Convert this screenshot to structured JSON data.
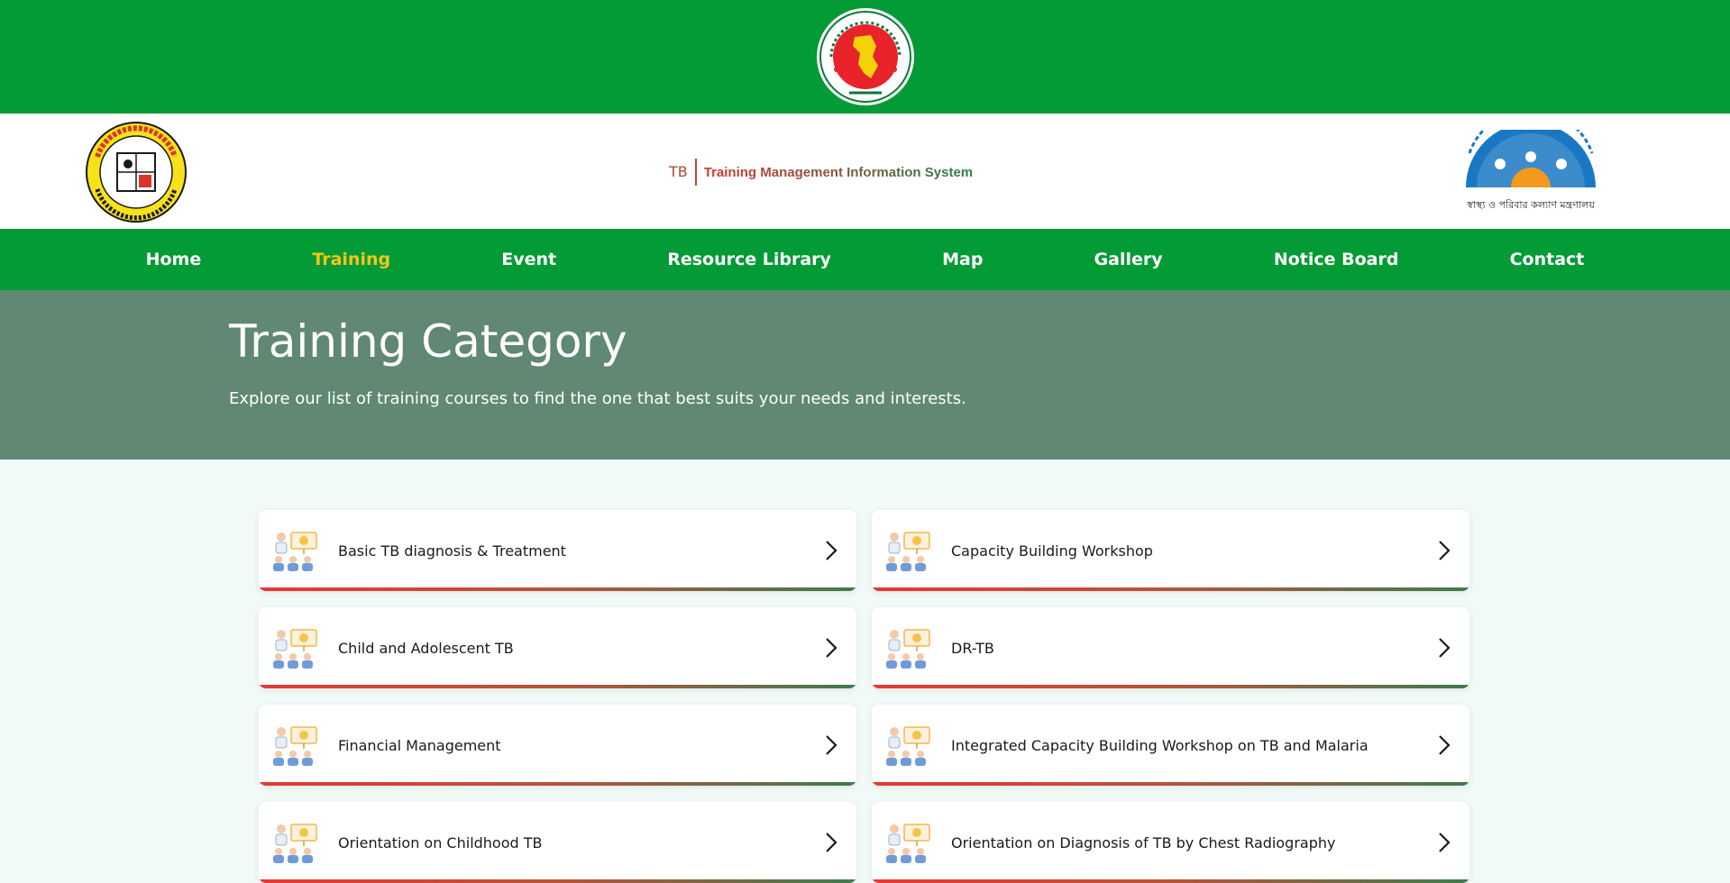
{
  "header": {
    "emblem_icon": "bangladesh-government-emblem",
    "left_logo_icon": "ntp-tb-program-logo",
    "right_logo_icon": "hpnsp-ministry-logo",
    "right_logo_caption": "স্বাস্থ্য ও পরিবার কল্যাণ মন্ত্রণালয়",
    "system_short": "TB",
    "system_title": "Training Management Information System"
  },
  "nav": {
    "items": [
      {
        "label": "Home"
      },
      {
        "label": "Training",
        "active": true
      },
      {
        "label": "Event"
      },
      {
        "label": "Resource Library"
      },
      {
        "label": "Map"
      },
      {
        "label": "Gallery"
      },
      {
        "label": "Notice Board"
      },
      {
        "label": "Contact"
      }
    ]
  },
  "hero": {
    "title": "Training Category",
    "subtitle": "Explore our list of training courses to find the one that best suits your needs and interests."
  },
  "categories": [
    {
      "label": "Basic TB diagnosis & Treatment",
      "icon": "training-presentation-icon"
    },
    {
      "label": "Capacity Building Workshop",
      "icon": "training-presentation-icon"
    },
    {
      "label": "Child and Adolescent TB",
      "icon": "training-presentation-icon"
    },
    {
      "label": "DR-TB",
      "icon": "training-presentation-icon"
    },
    {
      "label": "Financial Management",
      "icon": "training-presentation-icon"
    },
    {
      "label": "Integrated Capacity Building Workshop on TB and Malaria",
      "icon": "training-presentation-icon"
    },
    {
      "label": "Orientation on Childhood TB",
      "icon": "training-presentation-icon"
    },
    {
      "label": "Orientation on Diagnosis of TB by Chest Radiography",
      "icon": "training-presentation-icon"
    }
  ],
  "colors": {
    "primary_green": "#029b35",
    "hero_bg": "#608873",
    "active_nav": "#f5c518",
    "page_bg": "#f1faf6"
  }
}
